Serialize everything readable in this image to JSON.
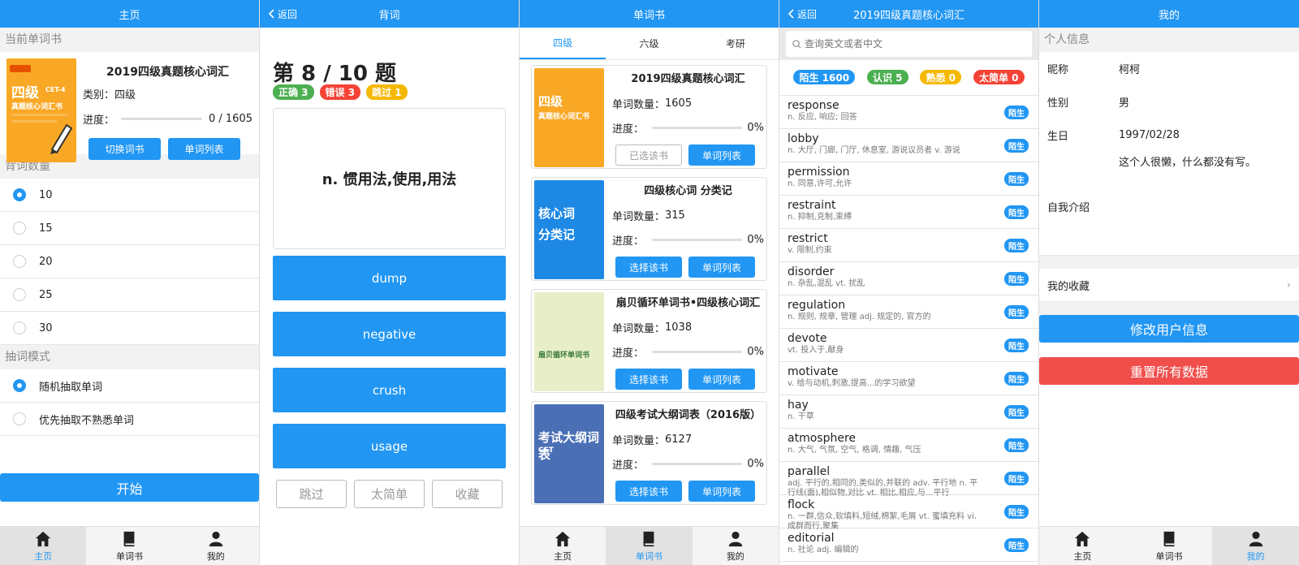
{
  "colors": {
    "primary": "#2196f3",
    "danger": "#ef4e4b",
    "green": "#4caf50",
    "red": "#f44336",
    "yellow": "#f5b800"
  },
  "tabbar": {
    "home": "主页",
    "books": "单词书",
    "mine": "我的"
  },
  "home": {
    "header": "主页",
    "current_book_section": "当前单词书",
    "book_title": "2019四级真题核心词汇",
    "category": "类别：四级",
    "progress_label": "进度：",
    "progress_text": "0 / 1605",
    "progress": 0,
    "switch_button": "切换词书",
    "list_button": "单词列表",
    "count_section": "背词数量",
    "counts": [
      "10",
      "15",
      "20",
      "25",
      "30"
    ],
    "selected_count": "10",
    "mode_section": "抽词模式",
    "modes": [
      "随机抽取单词",
      "优先抽取不熟悉单词"
    ],
    "selected_mode": "随机抽取单词",
    "start_button": "开始"
  },
  "quiz": {
    "header": "背词",
    "back": "返回",
    "question_title": "第 8 / 10 题",
    "correct": "正确 3",
    "wrong": "错误 3",
    "skipped": "跳过 1",
    "definition": "n. 惯用法,使用,用法",
    "options": [
      "dump",
      "negative",
      "crush",
      "usage"
    ],
    "skip_button": "跳过",
    "easy_button": "太简单",
    "fav_button": "收藏"
  },
  "books": {
    "header": "单词书",
    "tabs": [
      "四级",
      "六级",
      "考研"
    ],
    "active_tab": "四级",
    "count_prefix": "单词数量：",
    "progress_label": "进度：",
    "list_button": "单词列表",
    "items": [
      {
        "title": "2019四级真题核心词汇",
        "count": "1605",
        "progress": "0%",
        "select": "已选该书",
        "selected": true,
        "cover_text": "四级",
        "cover_sub": "真题核心词汇书",
        "cover_color": "#f9a825"
      },
      {
        "title": "四级核心词 分类记",
        "count": "315",
        "progress": "0%",
        "select": "选择该书",
        "selected": false,
        "cover_text": "核心词",
        "cover_sub": "分类记",
        "cover_color": "#1e88e5"
      },
      {
        "title": "扇贝循环单词书•四级核心词汇",
        "count": "1038",
        "progress": "0%",
        "select": "选择该书",
        "selected": false,
        "cover_text": "扇贝循环单词书",
        "cover_sub": "",
        "cover_color": "#e8efc8"
      },
      {
        "title": "四级考试大纲词表（2016版）",
        "count": "6127",
        "progress": "0%",
        "select": "选择该书",
        "selected": false,
        "cover_text": "考试大纲词表",
        "cover_sub": "CET",
        "cover_color": "#4a6fb5"
      }
    ]
  },
  "wordlist": {
    "header": "2019四级真题核心词汇",
    "back": "返回",
    "search_placeholder": "查询英文或者中文",
    "stats": [
      {
        "label": "陌生 1600",
        "color": "#2196f3"
      },
      {
        "label": "认识 5",
        "color": "#4caf50"
      },
      {
        "label": "熟悉 0",
        "color": "#f5b800"
      },
      {
        "label": "太简单 0",
        "color": "#f44336"
      }
    ],
    "tag": "陌生",
    "words": [
      {
        "w": "response",
        "m": "n. 反应, 响应; 回答"
      },
      {
        "w": "lobby",
        "m": "n. 大厅, 门廊, 门厅, 休息室, 游说议员者 v. 游说"
      },
      {
        "w": "permission",
        "m": "n. 同意,许可,允许"
      },
      {
        "w": "restraint",
        "m": "n. 抑制,克制,束缚"
      },
      {
        "w": "restrict",
        "m": "v. 限制,约束"
      },
      {
        "w": "disorder",
        "m": "n. 杂乱,混乱 vt. 扰乱"
      },
      {
        "w": "regulation",
        "m": "n. 规则, 规章, 管理 adj. 规定的, 官方的"
      },
      {
        "w": "devote",
        "m": "vt. 投入于,献身"
      },
      {
        "w": "motivate",
        "m": "v. 给与动机,刺激,提高...的学习欲望"
      },
      {
        "w": "hay",
        "m": "n. 干草"
      },
      {
        "w": "atmosphere",
        "m": "n. 大气, 气氛, 空气, 格调, 情趣, 气压"
      },
      {
        "w": "parallel",
        "m": "adj. 平行的,相同的,类似的,并联的 adv. 平行地 n. 平行线(面),相似物,对比 vt. 相比,相应,与...平行"
      },
      {
        "w": "flock",
        "m": "n. 一群,信众,软填料,短绒,棉絮,毛屑 vt. 蜜填充料 vi. 成群而行,聚集"
      },
      {
        "w": "editorial",
        "m": "n. 社论 adj. 编辑的"
      }
    ]
  },
  "profile": {
    "header": "我的",
    "section": "个人信息",
    "nickname_label": "昵称",
    "nickname": "柯柯",
    "gender_label": "性别",
    "gender": "男",
    "birthday_label": "生日",
    "birthday": "1997/02/28",
    "intro_label": "自我介绍",
    "intro": "这个人很懒，什么都没有写。",
    "favorites": "我的收藏",
    "edit_button": "修改用户信息",
    "reset_button": "重置所有数据"
  }
}
